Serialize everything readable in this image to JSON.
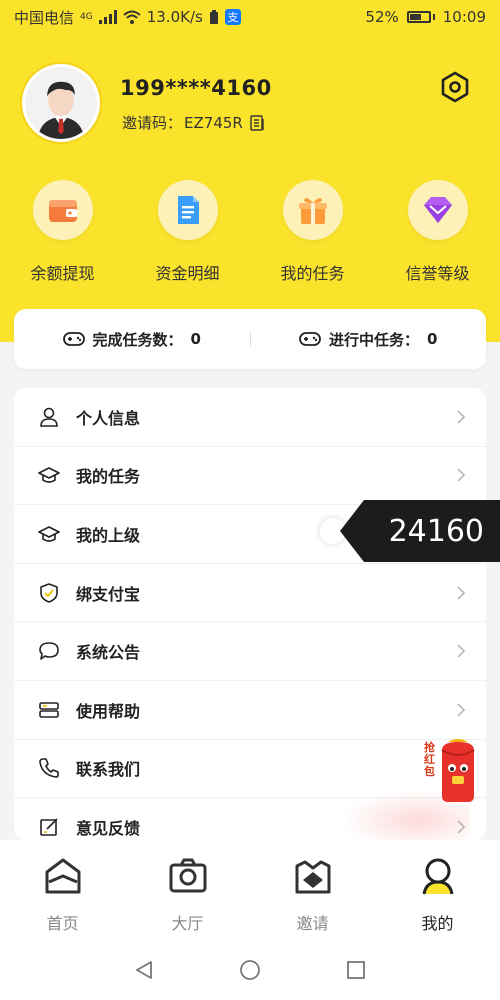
{
  "status_bar": {
    "carrier": "中国电信",
    "network": "4G",
    "speed": "13.0K/s",
    "battery": "52%",
    "time": "10:09"
  },
  "profile": {
    "phone": "199****4160",
    "invite_label": "邀请码：",
    "invite_code": "EZ745R"
  },
  "quick_actions": [
    {
      "label": "余额提现",
      "icon": "wallet-icon"
    },
    {
      "label": "资金明细",
      "icon": "document-icon"
    },
    {
      "label": "我的任务",
      "icon": "gift-icon"
    },
    {
      "label": "信誉等级",
      "icon": "diamond-icon"
    }
  ],
  "task_stats": {
    "completed_label": "完成任务数：",
    "completed_value": "0",
    "in_progress_label": "进行中任务：",
    "in_progress_value": "0"
  },
  "menu": [
    {
      "label": "个人信息",
      "icon": "user-icon"
    },
    {
      "label": "我的任务",
      "icon": "graduation-cap-icon"
    },
    {
      "label": "我的上级",
      "icon": "graduation-cap-icon"
    },
    {
      "label": "绑支付宝",
      "icon": "shield-check-icon"
    },
    {
      "label": "系统公告",
      "icon": "chat-bubble-icon"
    },
    {
      "label": "使用帮助",
      "icon": "server-icon"
    },
    {
      "label": "联系我们",
      "icon": "phone-icon"
    },
    {
      "label": "意见反馈",
      "icon": "feedback-icon"
    }
  ],
  "float_banner": {
    "text": "24160"
  },
  "redpacket": {
    "text": "抢红包"
  },
  "bottom_nav": [
    {
      "label": "首页",
      "icon": "home-icon",
      "active": false
    },
    {
      "label": "大厅",
      "icon": "camera-icon",
      "active": false
    },
    {
      "label": "邀请",
      "icon": "envelope-icon",
      "active": false
    },
    {
      "label": "我的",
      "icon": "profile-icon",
      "active": true
    }
  ],
  "colors": {
    "brand_yellow": "#fbe32b",
    "quick_circle": "#fdf1b8",
    "inactive_nav": "#888888",
    "redpacket_red": "#d83a1a"
  }
}
